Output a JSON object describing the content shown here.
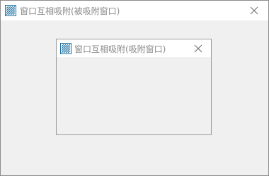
{
  "outer_window": {
    "title": "窗口互相吸附(被吸附窗口)",
    "icon": "app-logo-icon",
    "close_icon": "close-icon"
  },
  "inner_window": {
    "title": "窗口互相吸附(吸附窗口)",
    "icon": "app-logo-icon",
    "close_icon": "close-icon"
  },
  "colors": {
    "client_background": "#f0f0f0",
    "titlebar_background": "#ffffff",
    "title_text": "#8a8a8a",
    "border": "#8c8c8c",
    "icon_accent": "#1b6fa0"
  }
}
